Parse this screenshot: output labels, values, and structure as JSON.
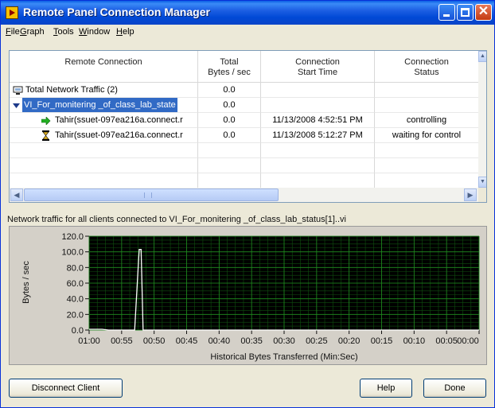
{
  "window": {
    "title": "Remote Panel Connection Manager"
  },
  "menu": [
    {
      "key": "F",
      "rest": "ile"
    },
    {
      "key": "G",
      "rest": "raph"
    },
    {
      "key": "T",
      "rest": "ools"
    },
    {
      "key": "W",
      "rest": "indow"
    },
    {
      "key": "H",
      "rest": "elp"
    }
  ],
  "table": {
    "headers": [
      {
        "line1": "Remote Connection",
        "line2": ""
      },
      {
        "line1": "Total",
        "line2": "Bytes / sec"
      },
      {
        "line1": "Connection",
        "line2": "Start Time"
      },
      {
        "line1": "Connection",
        "line2": "Status"
      }
    ],
    "rows": [
      {
        "icon": "network-computer-icon",
        "connection": "Total Network Traffic (2)",
        "bytes": "0.0",
        "start": "",
        "status": ""
      },
      {
        "icon": "expand-triangle-icon",
        "connection": "VI_For_monitering _of_class_lab_state",
        "bytes": "0.0",
        "start": "",
        "status": ""
      },
      {
        "icon": "green-arrow-icon",
        "connection": "Tahir(ssuet-097ea216a.connect.r",
        "bytes": "0.0",
        "start": "11/13/2008 4:52:51 PM",
        "status": "controlling"
      },
      {
        "icon": "hourglass-icon",
        "connection": "Tahir(ssuet-097ea216a.connect.r",
        "bytes": "0.0",
        "start": "11/13/2008 5:12:27 PM",
        "status": "waiting for control"
      }
    ]
  },
  "traffic_label": "Network traffic for all clients connected to VI_For_monitering _of_class_lab_status[1]..vi",
  "chart_data": {
    "type": "line",
    "title": "",
    "xlabel": "Historical Bytes Transferred (Min:Sec)",
    "ylabel": "Bytes / sec",
    "ylim": [
      0,
      120
    ],
    "xlim": [
      60,
      0
    ],
    "x_tick_labels": [
      "01:00",
      "00:55",
      "00:50",
      "00:45",
      "00:40",
      "00:35",
      "00:30",
      "00:25",
      "00:20",
      "00:15",
      "00:10",
      "00:05",
      "00:00"
    ],
    "y_tick_labels": [
      "0.0",
      "20.0",
      "40.0",
      "60.0",
      "80.0",
      "100.0",
      "120.0"
    ],
    "y_ticks": [
      0,
      20,
      40,
      60,
      80,
      100,
      120
    ],
    "x_ticks": [
      60,
      55,
      50,
      45,
      40,
      35,
      30,
      25,
      20,
      15,
      10,
      5,
      0
    ],
    "grid": true,
    "series": [
      {
        "x": [
          60,
          59,
          58,
          57,
          56,
          55,
          54,
          53,
          52.3,
          52,
          51.7,
          51,
          50,
          45,
          40,
          35,
          30,
          25,
          20,
          15,
          10,
          5,
          0
        ],
        "values": [
          1,
          1,
          1,
          0,
          0,
          0,
          0,
          0,
          103,
          103,
          0,
          0,
          0,
          0,
          0,
          0,
          0,
          0,
          0,
          0,
          0,
          0,
          0
        ]
      }
    ],
    "colors": {
      "background": "#000000",
      "grid": "#0f4f0f",
      "line": "#ffffff"
    }
  },
  "buttons": {
    "disconnect": "Disconnect Client",
    "help": "Help",
    "done": "Done"
  }
}
